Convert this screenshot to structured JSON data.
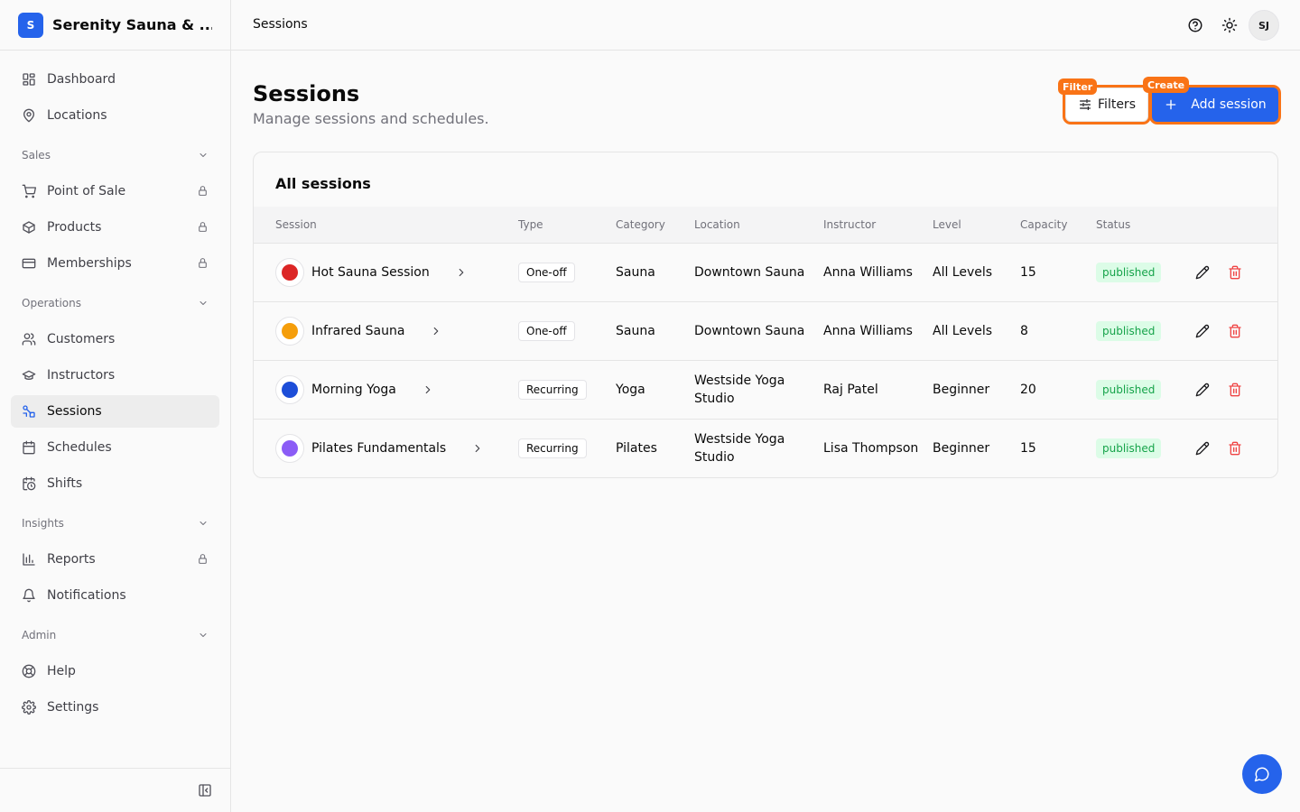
{
  "brand": {
    "logo_letter": "S",
    "name": "Serenity Sauna & ..."
  },
  "nav": {
    "top": [
      {
        "label": "Dashboard",
        "icon": "dashboard-icon"
      },
      {
        "label": "Locations",
        "icon": "map-pin-icon"
      }
    ],
    "groups": [
      {
        "title": "Sales",
        "items": [
          {
            "label": "Point of Sale",
            "icon": "cart-icon",
            "locked": true
          },
          {
            "label": "Products",
            "icon": "package-icon",
            "locked": true
          },
          {
            "label": "Memberships",
            "icon": "card-icon",
            "locked": true
          }
        ]
      },
      {
        "title": "Operations",
        "items": [
          {
            "label": "Customers",
            "icon": "users-icon"
          },
          {
            "label": "Instructors",
            "icon": "graduation-cap-icon"
          },
          {
            "label": "Sessions",
            "icon": "sessions-icon",
            "active": true
          },
          {
            "label": "Schedules",
            "icon": "calendar-icon"
          },
          {
            "label": "Shifts",
            "icon": "calendar-clock-icon"
          }
        ]
      },
      {
        "title": "Insights",
        "items": [
          {
            "label": "Reports",
            "icon": "bar-chart-icon",
            "locked": true
          },
          {
            "label": "Notifications",
            "icon": "bell-icon"
          }
        ]
      },
      {
        "title": "Admin",
        "items": [
          {
            "label": "Help",
            "icon": "life-buoy-icon"
          },
          {
            "label": "Settings",
            "icon": "gear-icon"
          }
        ]
      }
    ]
  },
  "topbar": {
    "title": "Sessions",
    "avatar_initials": "SJ"
  },
  "page": {
    "title": "Sessions",
    "subtitle": "Manage sessions and schedules.",
    "filters_label": "Filters",
    "add_label": "Add session",
    "filter_tag": "Filter",
    "create_tag": "Create"
  },
  "table": {
    "title": "All sessions",
    "columns": [
      "Session",
      "Type",
      "Category",
      "Location",
      "Instructor",
      "Level",
      "Capacity",
      "Status"
    ],
    "rows": [
      {
        "name": "Hot Sauna Session",
        "color": "#dc2626",
        "type": "One-off",
        "category": "Sauna",
        "location": "Downtown Sauna",
        "instructor": "Anna Williams",
        "level": "All Levels",
        "capacity": "15",
        "status": "published"
      },
      {
        "name": "Infrared Sauna",
        "color": "#f59e0b",
        "type": "One-off",
        "category": "Sauna",
        "location": "Downtown Sauna",
        "instructor": "Anna Williams",
        "level": "All Levels",
        "capacity": "8",
        "status": "published"
      },
      {
        "name": "Morning Yoga",
        "color": "#1d4ed8",
        "type": "Recurring",
        "category": "Yoga",
        "location": "Westside Yoga Studio",
        "instructor": "Raj Patel",
        "level": "Beginner",
        "capacity": "20",
        "status": "published"
      },
      {
        "name": "Pilates Fundamentals",
        "color": "#8b5cf6",
        "type": "Recurring",
        "category": "Pilates",
        "location": "Westside Yoga Studio",
        "instructor": "Lisa Thompson",
        "level": "Beginner",
        "capacity": "15",
        "status": "published"
      }
    ]
  },
  "colors": {
    "accent": "#2563eb",
    "highlight": "#f97316",
    "status_published_bg": "#dcfce7",
    "status_published_fg": "#16a34a",
    "danger": "#ef4444"
  }
}
